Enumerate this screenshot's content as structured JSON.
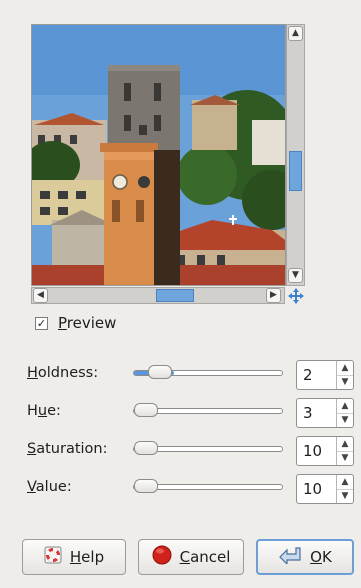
{
  "preview": {
    "checkbox_mark": "✓",
    "label_mnemonic": "P",
    "label_rest": "review",
    "checked": true
  },
  "controls": [
    {
      "label_mnemonic": "H",
      "label_rest": "oldness:",
      "value": "2",
      "slider_fraction": 0.18
    },
    {
      "label_pre": "H",
      "label_mnemonic": "u",
      "label_rest": "e:",
      "value": "3",
      "slider_fraction": 0.02
    },
    {
      "label_mnemonic": "S",
      "label_rest": "aturation:",
      "value": "10",
      "slider_fraction": 0.02
    },
    {
      "label_mnemonic": "V",
      "label_rest": "alue:",
      "value": "10",
      "slider_fraction": 0.02
    }
  ],
  "buttons": {
    "help": {
      "mnemonic": "H",
      "rest": "elp"
    },
    "cancel": {
      "mnemonic": "C",
      "rest": "ancel"
    },
    "ok": {
      "mnemonic": "O",
      "rest": "K"
    }
  },
  "icons": {
    "scroll_up": "▲",
    "scroll_down": "▼",
    "scroll_left": "◀",
    "scroll_right": "▶",
    "spin_up": "▲",
    "spin_down": "▼",
    "navigate": "navigate-move-icon",
    "help": "help-lifebuoy-icon",
    "cancel": "cancel-red-circle-icon",
    "ok": "ok-arrow-icon"
  },
  "colors": {
    "accent": "#5a97da",
    "cancel_red": "#d0221a"
  }
}
